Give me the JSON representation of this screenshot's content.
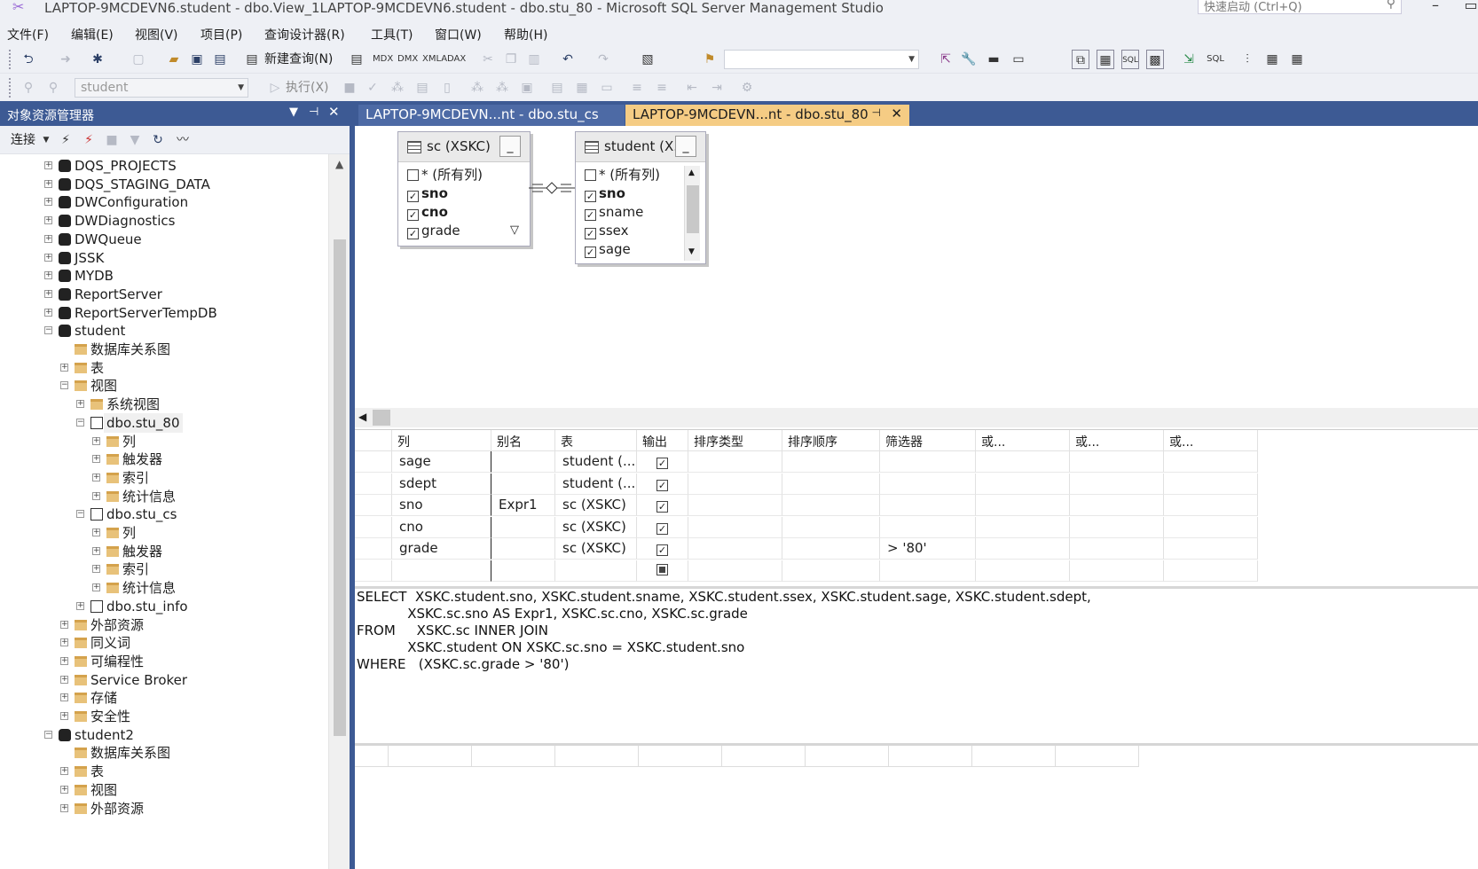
{
  "window": {
    "title": "LAPTOP-9MCDEVN6.student - dbo.View_1LAPTOP-9MCDEVN6.student - dbo.stu_80 - Microsoft SQL Server Management Studio",
    "quick_launch_placeholder": "快速启动 (Ctrl+Q)"
  },
  "menu": [
    "文件(F)",
    "编辑(E)",
    "视图(V)",
    "项目(P)",
    "查询设计器(R)",
    "工具(T)",
    "窗口(W)",
    "帮助(H)"
  ],
  "toolbar": {
    "new_query_label": "新建查询(N)",
    "database_combo": "student",
    "execute_label": "执行(X)"
  },
  "object_explorer": {
    "title": "对象资源管理器",
    "connect_label": "连接",
    "tree": [
      {
        "label": "DQS_PROJECTS",
        "level": 0,
        "icon": "database",
        "expander": "+"
      },
      {
        "label": "DQS_STAGING_DATA",
        "level": 0,
        "icon": "database",
        "expander": "+"
      },
      {
        "label": "DWConfiguration",
        "level": 0,
        "icon": "database",
        "expander": "+"
      },
      {
        "label": "DWDiagnostics",
        "level": 0,
        "icon": "database",
        "expander": "+"
      },
      {
        "label": "DWQueue",
        "level": 0,
        "icon": "database",
        "expander": "+"
      },
      {
        "label": "JSSK",
        "level": 0,
        "icon": "database",
        "expander": "+"
      },
      {
        "label": "MYDB",
        "level": 0,
        "icon": "database",
        "expander": "+"
      },
      {
        "label": "ReportServer",
        "level": 0,
        "icon": "database",
        "expander": "+"
      },
      {
        "label": "ReportServerTempDB",
        "level": 0,
        "icon": "database",
        "expander": "+"
      },
      {
        "label": "student",
        "level": 0,
        "icon": "database",
        "expander": "-"
      },
      {
        "label": "数据库关系图",
        "level": 1,
        "icon": "folder",
        "expander": ""
      },
      {
        "label": "表",
        "level": 1,
        "icon": "folder",
        "expander": "+"
      },
      {
        "label": "视图",
        "level": 1,
        "icon": "folder",
        "expander": "-"
      },
      {
        "label": "系统视图",
        "level": 2,
        "icon": "folder",
        "expander": "+"
      },
      {
        "label": "dbo.stu_80",
        "level": 2,
        "icon": "view",
        "expander": "-",
        "selected": true
      },
      {
        "label": "列",
        "level": 3,
        "icon": "folder",
        "expander": "+"
      },
      {
        "label": "触发器",
        "level": 3,
        "icon": "folder",
        "expander": "+"
      },
      {
        "label": "索引",
        "level": 3,
        "icon": "folder",
        "expander": "+"
      },
      {
        "label": "统计信息",
        "level": 3,
        "icon": "folder",
        "expander": "+"
      },
      {
        "label": "dbo.stu_cs",
        "level": 2,
        "icon": "view",
        "expander": "-"
      },
      {
        "label": "列",
        "level": 3,
        "icon": "folder",
        "expander": "+"
      },
      {
        "label": "触发器",
        "level": 3,
        "icon": "folder",
        "expander": "+"
      },
      {
        "label": "索引",
        "level": 3,
        "icon": "folder",
        "expander": "+"
      },
      {
        "label": "统计信息",
        "level": 3,
        "icon": "folder",
        "expander": "+"
      },
      {
        "label": "dbo.stu_info",
        "level": 2,
        "icon": "view",
        "expander": "+"
      },
      {
        "label": "外部资源",
        "level": 1,
        "icon": "folder",
        "expander": "+"
      },
      {
        "label": "同义词",
        "level": 1,
        "icon": "folder",
        "expander": "+"
      },
      {
        "label": "可编程性",
        "level": 1,
        "icon": "folder",
        "expander": "+"
      },
      {
        "label": "Service Broker",
        "level": 1,
        "icon": "folder",
        "expander": "+"
      },
      {
        "label": "存储",
        "level": 1,
        "icon": "folder",
        "expander": "+"
      },
      {
        "label": "安全性",
        "level": 1,
        "icon": "folder",
        "expander": "+"
      },
      {
        "label": "student2",
        "level": 0,
        "icon": "database",
        "expander": "-"
      },
      {
        "label": "数据库关系图",
        "level": 1,
        "icon": "folder",
        "expander": ""
      },
      {
        "label": "表",
        "level": 1,
        "icon": "folder",
        "expander": "+"
      },
      {
        "label": "视图",
        "level": 1,
        "icon": "folder",
        "expander": "+"
      },
      {
        "label": "外部资源",
        "level": 1,
        "icon": "folder",
        "expander": "+"
      }
    ]
  },
  "tabs": [
    {
      "label": "LAPTOP-9MCDEVN...nt - dbo.stu_cs",
      "active": false
    },
    {
      "label": "LAPTOP-9MCDEVN...nt - dbo.stu_80",
      "active": true
    }
  ],
  "diagram": {
    "tables": [
      {
        "title": "sc (XSKC)",
        "columns": [
          {
            "name": "* (所有列)",
            "checked": false,
            "bold": false
          },
          {
            "name": "sno",
            "checked": true,
            "bold": true
          },
          {
            "name": "cno",
            "checked": true,
            "bold": true
          },
          {
            "name": "grade",
            "checked": true,
            "bold": false,
            "filter": true
          }
        ]
      },
      {
        "title": "student (X...",
        "columns": [
          {
            "name": "* (所有列)",
            "checked": false,
            "bold": false
          },
          {
            "name": "sno",
            "checked": true,
            "bold": true
          },
          {
            "name": "sname",
            "checked": true,
            "bold": false
          },
          {
            "name": "ssex",
            "checked": true,
            "bold": false
          },
          {
            "name": "sage",
            "checked": true,
            "bold": false
          }
        ]
      }
    ]
  },
  "criteria": {
    "headers": [
      "列",
      "别名",
      "表",
      "输出",
      "排序类型",
      "排序顺序",
      "筛选器",
      "或...",
      "或...",
      "或..."
    ],
    "rows": [
      {
        "column": "sage",
        "alias": "",
        "table": "student (...",
        "output": true,
        "filter": ""
      },
      {
        "column": "sdept",
        "alias": "",
        "table": "student (...",
        "output": true,
        "filter": ""
      },
      {
        "column": "sno",
        "alias": "Expr1",
        "table": "sc (XSKC)",
        "output": true,
        "filter": ""
      },
      {
        "column": "cno",
        "alias": "",
        "table": "sc (XSKC)",
        "output": true,
        "filter": ""
      },
      {
        "column": "grade",
        "alias": "",
        "table": "sc (XSKC)",
        "output": true,
        "filter": "> '80'"
      }
    ]
  },
  "sql": [
    "SELECT  XSKC.student.sno, XSKC.student.sname, XSKC.student.ssex, XSKC.student.sage, XSKC.student.sdept,",
    "            XSKC.sc.sno AS Expr1, XSKC.sc.cno, XSKC.sc.grade",
    "FROM     XSKC.sc INNER JOIN",
    "            XSKC.student ON XSKC.sc.sno = XSKC.student.sno",
    "WHERE   (XSKC.sc.grade > '80')"
  ],
  "colors": {
    "accent": "#3d5a94",
    "active_tab": "#f5cc84"
  }
}
